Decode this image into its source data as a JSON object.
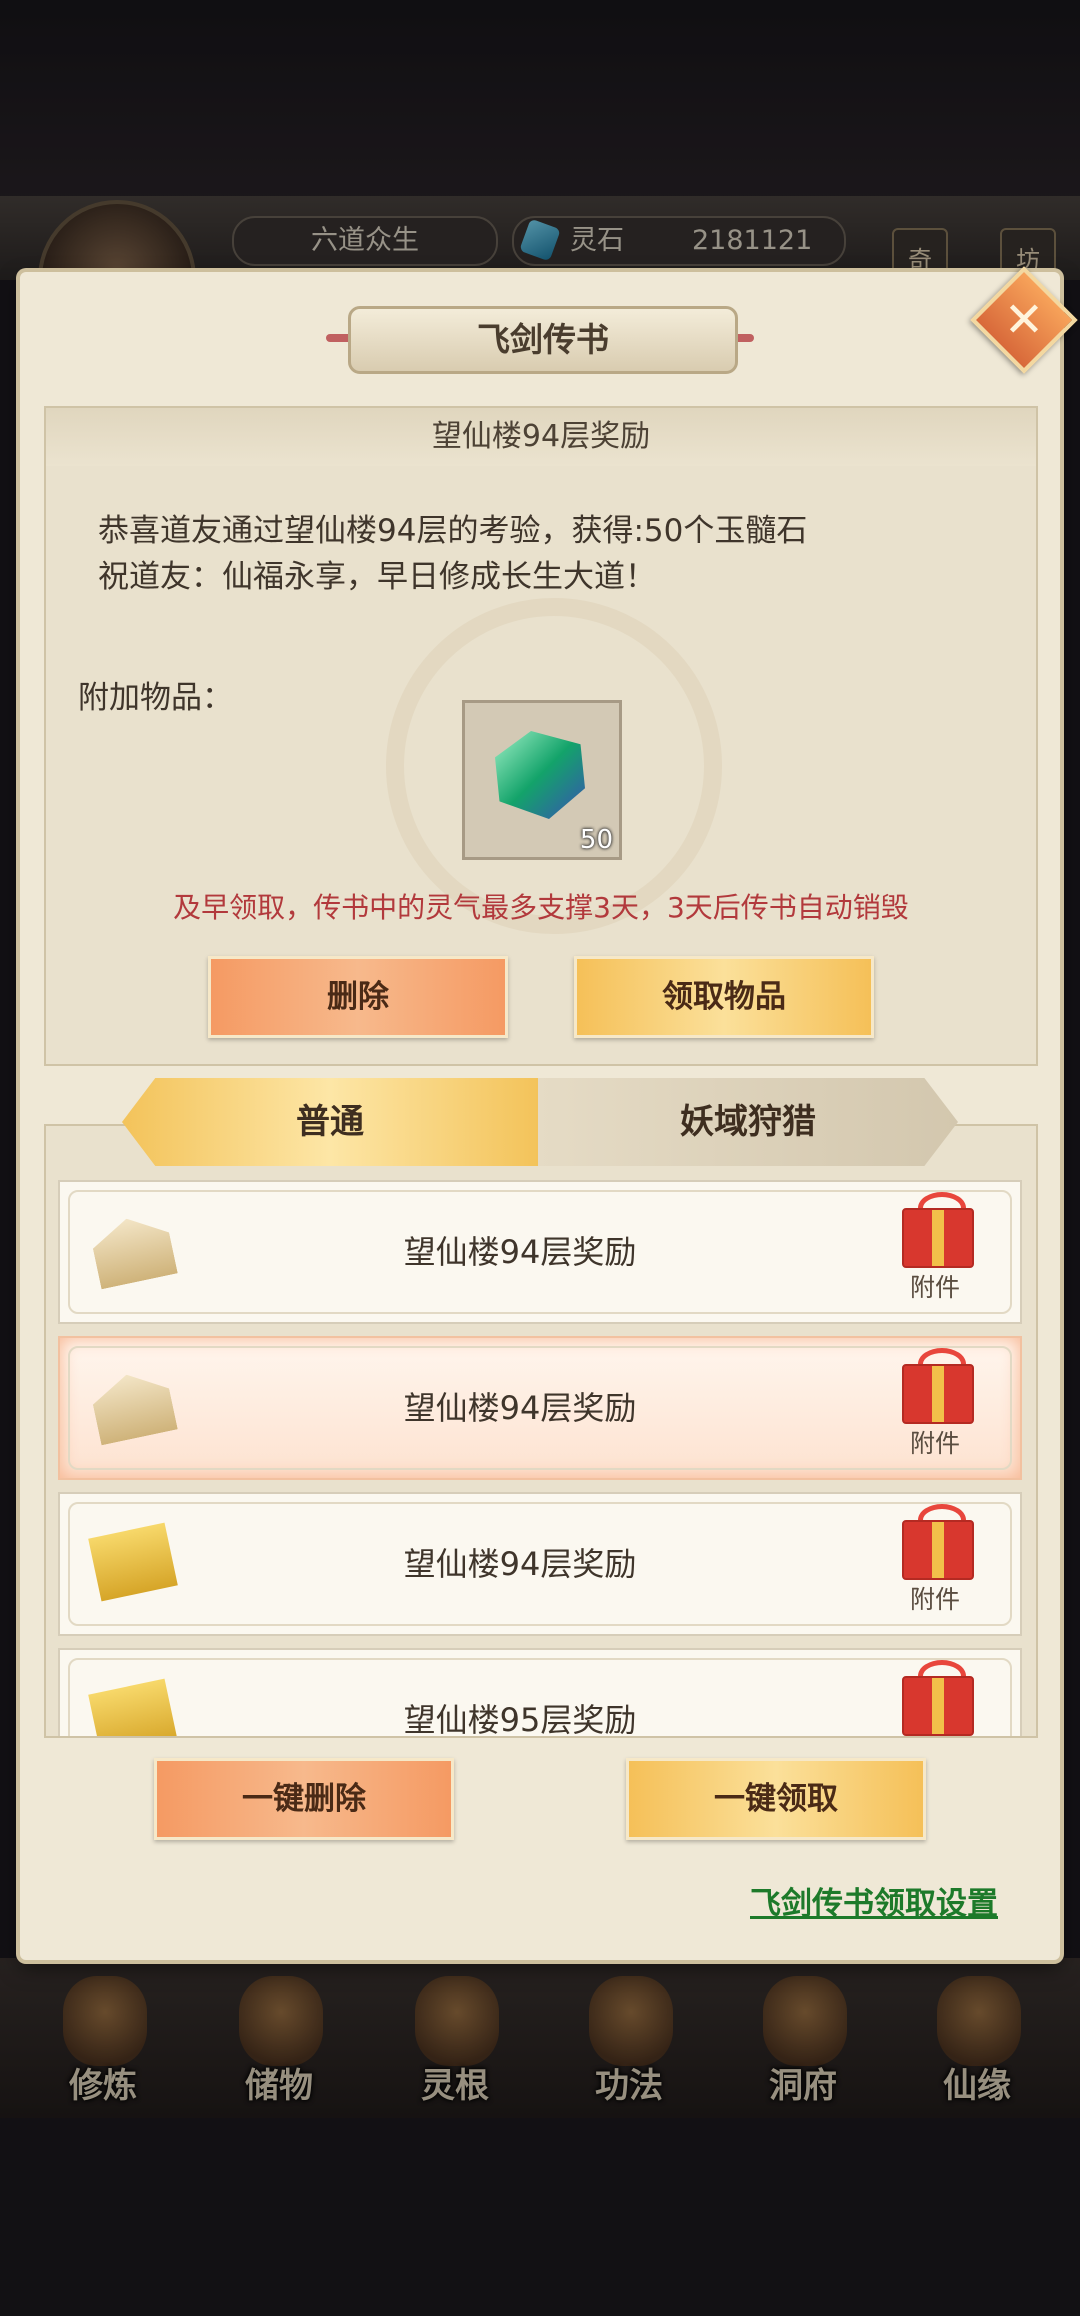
{
  "hud": {
    "player_name": "六道众生",
    "currency_label": "灵石",
    "currency_value": "2181121",
    "side_chips": [
      "奇",
      "坊"
    ]
  },
  "bottom_nav": {
    "items": [
      {
        "label": "修炼",
        "icon": "meditation-icon"
      },
      {
        "label": "储物",
        "icon": "storage-bag-icon"
      },
      {
        "label": "灵根",
        "icon": "spirit-root-icon"
      },
      {
        "label": "功法",
        "icon": "scripture-icon"
      },
      {
        "label": "洞府",
        "icon": "cave-dwelling-icon"
      },
      {
        "label": "仙缘",
        "icon": "fortune-icon"
      }
    ]
  },
  "modal": {
    "title": "飞剑传书",
    "close_icon": "close-icon"
  },
  "detail": {
    "subject": "望仙楼94层奖励",
    "body_line1": "恭喜道友通过望仙楼94层的考验，获得:50个玉髓石",
    "body_line2": "祝道友：仙福永享，早日修成长生大道！",
    "attachment_label": "附加物品：",
    "attachment_item": {
      "icon": "jade-stone-icon",
      "count": "50"
    },
    "warning": "及早领取，传书中的灵气最多支撑3天，3天后传书自动销毁",
    "delete_label": "删除",
    "claim_label": "领取物品"
  },
  "tabs": [
    {
      "label": "普通",
      "active": true
    },
    {
      "label": "妖域狩猎",
      "active": false
    }
  ],
  "mail_list": [
    {
      "title": "望仙楼94层奖励",
      "attachment": "附件",
      "envelope": "opened",
      "selected": false
    },
    {
      "title": "望仙楼94层奖励",
      "attachment": "附件",
      "envelope": "opened",
      "selected": true
    },
    {
      "title": "望仙楼94层奖励",
      "attachment": "附件",
      "envelope": "closed",
      "selected": false
    },
    {
      "title": "望仙楼95层奖励",
      "attachment": "",
      "envelope": "closed",
      "selected": false
    }
  ],
  "actions": {
    "delete_all_label": "一键删除",
    "claim_all_label": "一键领取",
    "settings_link": "飞剑传书领取设置"
  },
  "colors": {
    "warning_red": "#b2393c",
    "link_green": "#1d7a2a",
    "button_orange": "#f59a63",
    "button_gold": "#f5c058"
  }
}
